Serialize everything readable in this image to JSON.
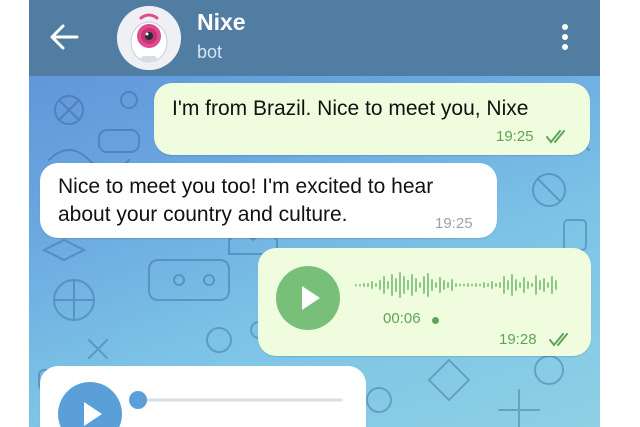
{
  "chat": {
    "name": "Nixe",
    "status": "bot"
  },
  "messages": [
    {
      "direction": "outgoing",
      "text": "I'm from Brazil. Nice to meet you, Nixe",
      "time": "19:25",
      "read": true
    },
    {
      "direction": "incoming",
      "lines": [
        "Nice to meet you too! I'm excited to hear",
        "about your country and culture."
      ],
      "time": "19:25"
    },
    {
      "direction": "outgoing",
      "type": "voice",
      "duration": "00:06",
      "time": "19:28",
      "read": true
    },
    {
      "direction": "incoming",
      "type": "voice",
      "partial": true
    }
  ],
  "icons": {
    "back": "arrow-left-icon",
    "menu": "more-vertical-icon",
    "play": "play-icon",
    "read": "double-check-icon"
  },
  "colors": {
    "header": "#517da2",
    "outgoing_bubble": "#effdde",
    "incoming_bubble": "#ffffff",
    "play_button_out": "#78c07a",
    "play_button_in": "#5a9fd8",
    "accent_green": "#5fa35a"
  }
}
